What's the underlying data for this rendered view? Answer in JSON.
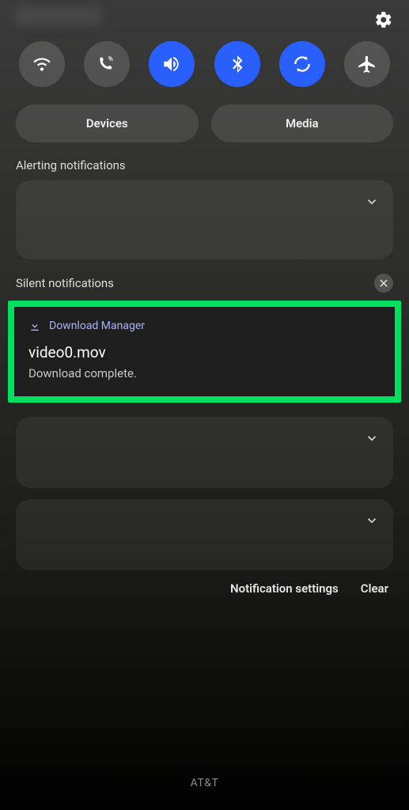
{
  "quick_settings": {
    "devices_label": "Devices",
    "media_label": "Media"
  },
  "sections": {
    "alerting_label": "Alerting notifications",
    "silent_label": "Silent notifications"
  },
  "download_notification": {
    "app_name": "Download Manager",
    "title": "video0.mov",
    "subtitle": "Download complete."
  },
  "footer": {
    "settings_label": "Notification settings",
    "clear_label": "Clear"
  },
  "carrier": "AT&T",
  "toggles": {
    "wifi_active": false,
    "wifi_calling_active": false,
    "sound_active": true,
    "bluetooth_active": true,
    "rotate_active": true,
    "airplane_active": false
  },
  "highlight_color": "#00e060"
}
